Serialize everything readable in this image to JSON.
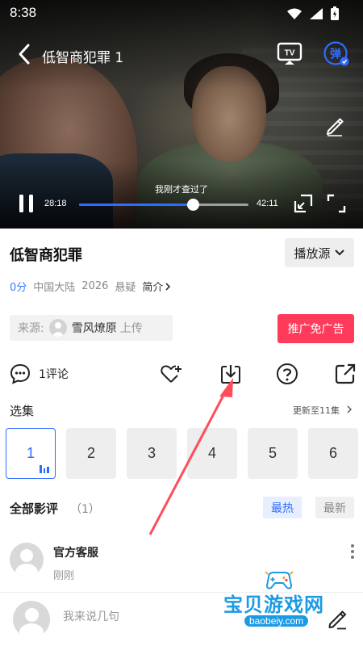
{
  "status_bar": {
    "time": "8:38",
    "icons": [
      "wifi-icon",
      "signal-icon",
      "battery-icon"
    ]
  },
  "player": {
    "title": "低智商犯罪 1",
    "subtitle": "我刚才查过了",
    "current_time": "28:18",
    "total_time": "42:11",
    "progress_fraction": 0.67,
    "danmu_label": "弹",
    "tv_label": "TV"
  },
  "show": {
    "title": "低智商犯罪",
    "source_select": "播放源",
    "score": "0分",
    "region": "中国大陆",
    "year": "2026",
    "genre": "悬疑",
    "intro": "简介",
    "uploader_label": "来源:",
    "uploader_name": "雪风燎原",
    "uploader_suffix": "上传",
    "promo_button": "推广免广告"
  },
  "actions": {
    "comment_count": "1评论",
    "icons": [
      "comment-icon",
      "favorite-icon",
      "download-icon",
      "help-icon",
      "share-icon"
    ]
  },
  "episodes": {
    "heading": "选集",
    "update_text": "更新至11集",
    "items": [
      "1",
      "2",
      "3",
      "4",
      "5",
      "6"
    ],
    "active_index": 0
  },
  "reviews": {
    "heading": "全部影评",
    "count": "（1）",
    "sort_hot": "最热",
    "sort_new": "最新",
    "items": [
      {
        "name": "官方客服",
        "time": "刚刚"
      }
    ]
  },
  "comment_bar": {
    "placeholder": "我来说几句"
  },
  "watermark": {
    "text": "宝贝游戏网",
    "url": "baobeiy.com"
  },
  "colors": {
    "accent": "#2f6bff",
    "promo": "#ff3b5c",
    "arrow": "#ff4d5a"
  }
}
